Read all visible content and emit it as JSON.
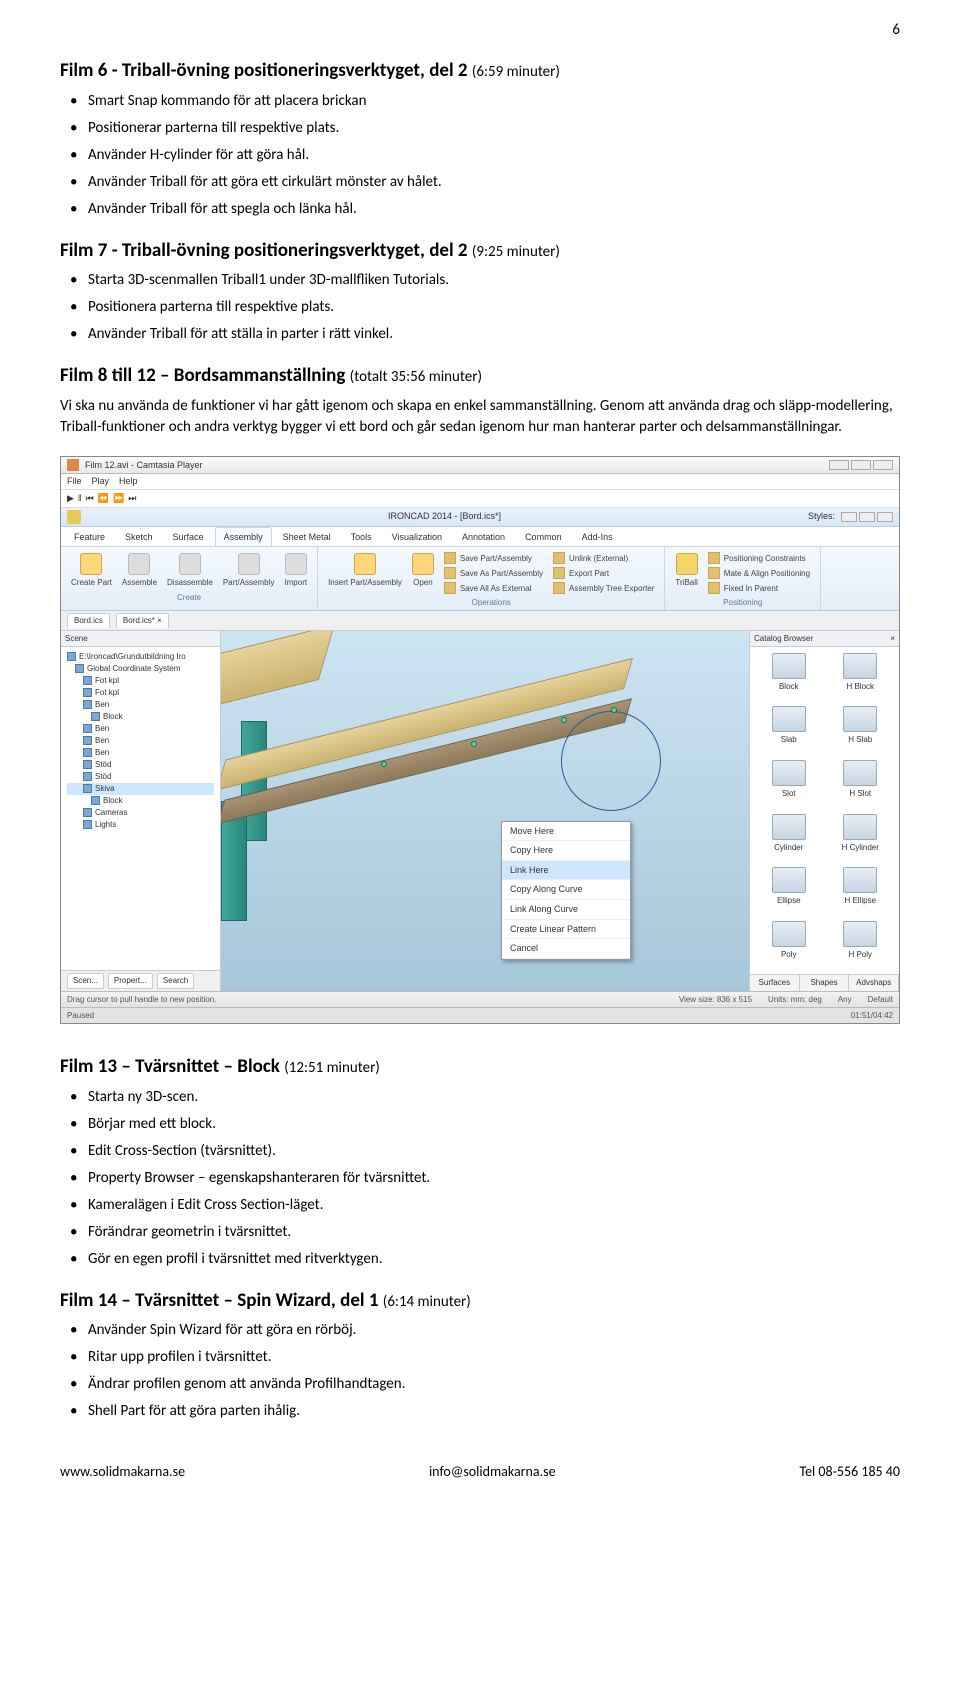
{
  "page_number": "6",
  "sections": [
    {
      "title": "Film 6 - Triball-övning positioneringsverktyget, del 2",
      "duration": "(6:59 minuter)",
      "bullets": [
        "Smart Snap kommando för att placera brickan",
        "Positionerar parterna till respektive plats.",
        "Använder H-cylinder för att göra hål.",
        "Använder Triball för att göra ett cirkulärt mönster av hålet.",
        "Använder Triball för att spegla och länka hål."
      ]
    },
    {
      "title": "Film 7 - Triball-övning positioneringsverktyget, del 2",
      "duration": "(9:25 minuter)",
      "bullets": [
        "Starta 3D-scenmallen Triball1 under 3D-mallfliken Tutorials.",
        "Positionera parterna till respektive plats.",
        "Använder Triball för att ställa in parter i rätt vinkel."
      ]
    },
    {
      "title": "Film 8 till 12 – Bordsammanställning",
      "duration": "(totalt 35:56 minuter)",
      "paragraph": "Vi ska nu använda de funktioner vi har gått igenom och skapa en enkel sammanställning. Genom att använda drag och släpp-modellering, Triball-funktioner och andra verktyg bygger vi ett bord och går sedan igenom hur man hanterar parter och delsammanställningar."
    },
    {
      "title": "Film 13 – Tvärsnittet – Block",
      "duration": "(12:51 minuter)",
      "bullets": [
        "Starta ny 3D-scen.",
        "Börjar med ett block.",
        "Edit Cross-Section (tvärsnittet).",
        "Property Browser – egenskapshanteraren för tvärsnittet.",
        "Kameralägen i Edit Cross Section-läget.",
        "Förändrar geometrin i tvärsnittet.",
        "Gör en egen profil i tvärsnittet med ritverktygen."
      ]
    },
    {
      "title": "Film 14 – Tvärsnittet – Spin Wizard, del 1",
      "duration": "(6:14 minuter)",
      "bullets": [
        "Använder Spin Wizard för att göra en rörböj.",
        "Ritar upp profilen i tvärsnittet.",
        "Ändrar profilen genom att använda Profilhandtagen.",
        "Shell Part för att göra parten ihålig."
      ]
    }
  ],
  "screenshot": {
    "player_title": "Film 12.avi - Camtasia Player",
    "player_menu": [
      "File",
      "Play",
      "Help"
    ],
    "app_title": "IRONCAD 2014 - [Bord.ics*]",
    "styles_label": "Styles:",
    "ribbon_tabs": [
      "Feature",
      "Sketch",
      "Surface",
      "Assembly",
      "Sheet Metal",
      "Tools",
      "Visualization",
      "Annotation",
      "Common",
      "Add-Ins"
    ],
    "ribbon_active": "Assembly",
    "groups": {
      "create": {
        "buttons": [
          "Create Part",
          "Assemble",
          "Disassemble",
          "Part/Assembly",
          "Import"
        ],
        "label": "Create"
      },
      "operations": {
        "small": [
          "Save Part/Assembly",
          "Unlink (External)",
          "Save As Part/Assembly",
          "Export Part",
          "Save All As External",
          "Assembly Tree Exporter"
        ],
        "big": [
          "Insert Part/Assembly",
          "Open"
        ],
        "label": "Operations"
      },
      "positioning": {
        "big": "TriBall",
        "small": [
          "Positioning Constraints",
          "Mate & Align Positioning",
          "Fixed In Parent"
        ],
        "label": "Positioning"
      }
    },
    "scene_tabs": [
      "Bord.ics",
      "Bord.ics* ×"
    ],
    "scene_panel_title": "Scene",
    "tree": [
      "E:\\Ironcad\\Grundutbildning Iro",
      "Global Coordinate System",
      "Fot kpl",
      "Fot kpl",
      "Ben",
      "Block",
      "Ben",
      "Ben",
      "Ben",
      "Stöd",
      "Stöd",
      "Skiva",
      "Block",
      "Cameras",
      "Lights"
    ],
    "tree_selected_index": 11,
    "left_tabs": [
      "Scen...",
      "Propert...",
      "Search"
    ],
    "context_menu": [
      "Move Here",
      "Copy Here",
      "Link Here",
      "Copy Along Curve",
      "Link Along Curve",
      "Create Linear Pattern",
      "Cancel"
    ],
    "context_selected_index": 2,
    "catalog_title": "Catalog Browser",
    "catalog_items": [
      "Block",
      "H Block",
      "Slab",
      "H Slab",
      "Slot",
      "H Slot",
      "Cylinder",
      "H Cylinder",
      "Ellipse",
      "H Ellipse",
      "Poly",
      "H Poly"
    ],
    "catalog_tabs": [
      "Surfaces",
      "Shapes",
      "Advshaps"
    ],
    "statusbar": {
      "hint": "Drag cursor to pull handle to new position.",
      "viewsize": "View size: 836 x 515",
      "units": "Units: mm; deg",
      "any": "Any",
      "default": "Default"
    },
    "player_status": {
      "state": "Paused",
      "time": "01:51/04:42"
    }
  },
  "footer": {
    "left": "www.solidmakarna.se",
    "center": "info@solidmakarna.se",
    "right": "Tel 08-556 185 40"
  }
}
